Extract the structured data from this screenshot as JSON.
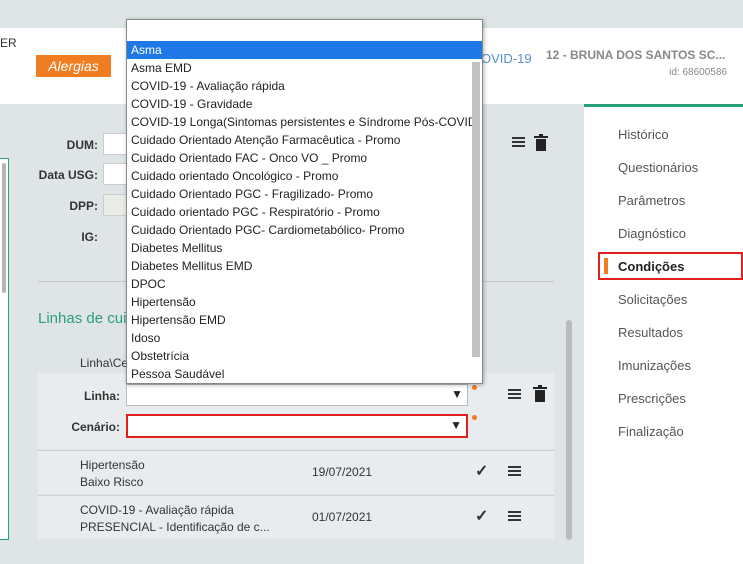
{
  "header": {
    "left_fragment": "ER",
    "alergias_label": "Alergias",
    "covid_tab": "OVID-19",
    "patient_name": "12 - BRUNA DOS SANTOS SC...",
    "patient_id": "id: 68600586"
  },
  "form": {
    "dum_label": "DUM:",
    "data_usg_label": "Data USG:",
    "dpp_label": "DPP:",
    "ig_label": "IG:"
  },
  "section": {
    "title": "Linhas de cui",
    "linha_header": "Linha\\Ce"
  },
  "selector": {
    "linha_label": "Linha:",
    "cenario_label": "Cenário:"
  },
  "rows": [
    {
      "line1": "Hipertensão",
      "line2": "Baixo Risco",
      "date": "19/07/2021"
    },
    {
      "line1": "COVID-19 - Avaliação rápida",
      "line2": "PRESENCIAL - Identificação de c...",
      "date": "01/07/2021"
    }
  ],
  "dropdown": {
    "options": [
      "Asma",
      "Asma EMD",
      "COVID-19 - Avaliação rápida",
      "COVID-19 - Gravidade",
      "COVID-19 Longa(Sintomas persistentes e Síndrome Pós-COVID)",
      "Cuidado Orientado Atenção Farmacêutica - Promo",
      "Cuidado Orientado FAC - Onco VO _ Promo",
      "Cuidado orientado Oncológico - Promo",
      "Cuidado Orientado PGC - Fragilizado- Promo",
      "Cuidado orientado PGC - Respiratório - Promo",
      "Cuidado Orientado PGC- Cardiometabólico- Promo",
      "Diabetes Mellitus",
      "Diabetes Mellitus EMD",
      "DPOC",
      "Hipertensão",
      "Hipertensão EMD",
      "Idoso",
      "Obstetrícia",
      "Pessoa Saudável"
    ],
    "selected": "Asma"
  },
  "sidebar": {
    "items": [
      "Histórico",
      "Questionários",
      "Parâmetros",
      "Diagnóstico",
      "Condições",
      "Solicitações",
      "Resultados",
      "Imunizações",
      "Prescrições",
      "Finalização"
    ],
    "active": "Condições"
  },
  "colors": {
    "accent_green": "#2aa07a",
    "accent_orange": "#f07d22",
    "highlight_red": "#e02020",
    "select_blue": "#1e78e6"
  }
}
